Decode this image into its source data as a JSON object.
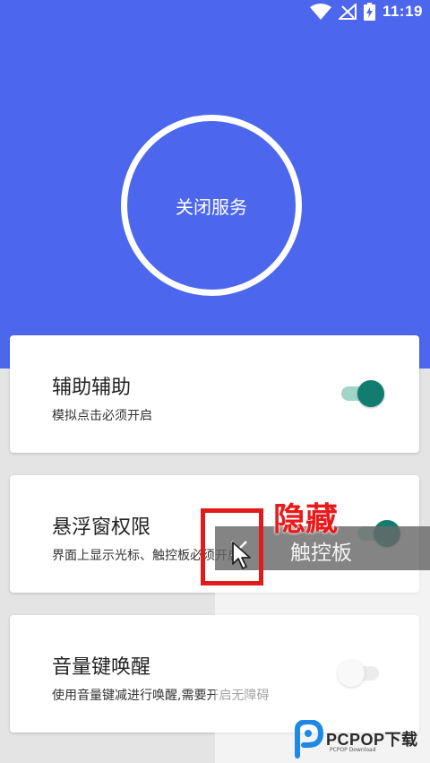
{
  "status_bar": {
    "time": "11:19"
  },
  "service": {
    "button_label": "关闭服务"
  },
  "settings": [
    {
      "title": "辅助辅助",
      "subtitle": "模拟点击必须开启",
      "enabled": true
    },
    {
      "title": "悬浮窗权限",
      "subtitle": "界面上显示光标、触控板必须开启",
      "enabled": true
    },
    {
      "title": "音量键唤醒",
      "subtitle": "使用音量键减进行唤醒,需要开启无障碍",
      "enabled": false
    }
  ],
  "float_panel": {
    "label": "触控板",
    "close_icon": "close-icon"
  },
  "annotation": {
    "text": "隐藏",
    "color": "#e81a1a"
  },
  "watermark": {
    "brand": "PCPOP下载",
    "small": "PCPOP Download"
  },
  "colors": {
    "accent": "#4c67ee",
    "toggle_on": "#127d6e",
    "annotation_red": "#e11b1b"
  }
}
